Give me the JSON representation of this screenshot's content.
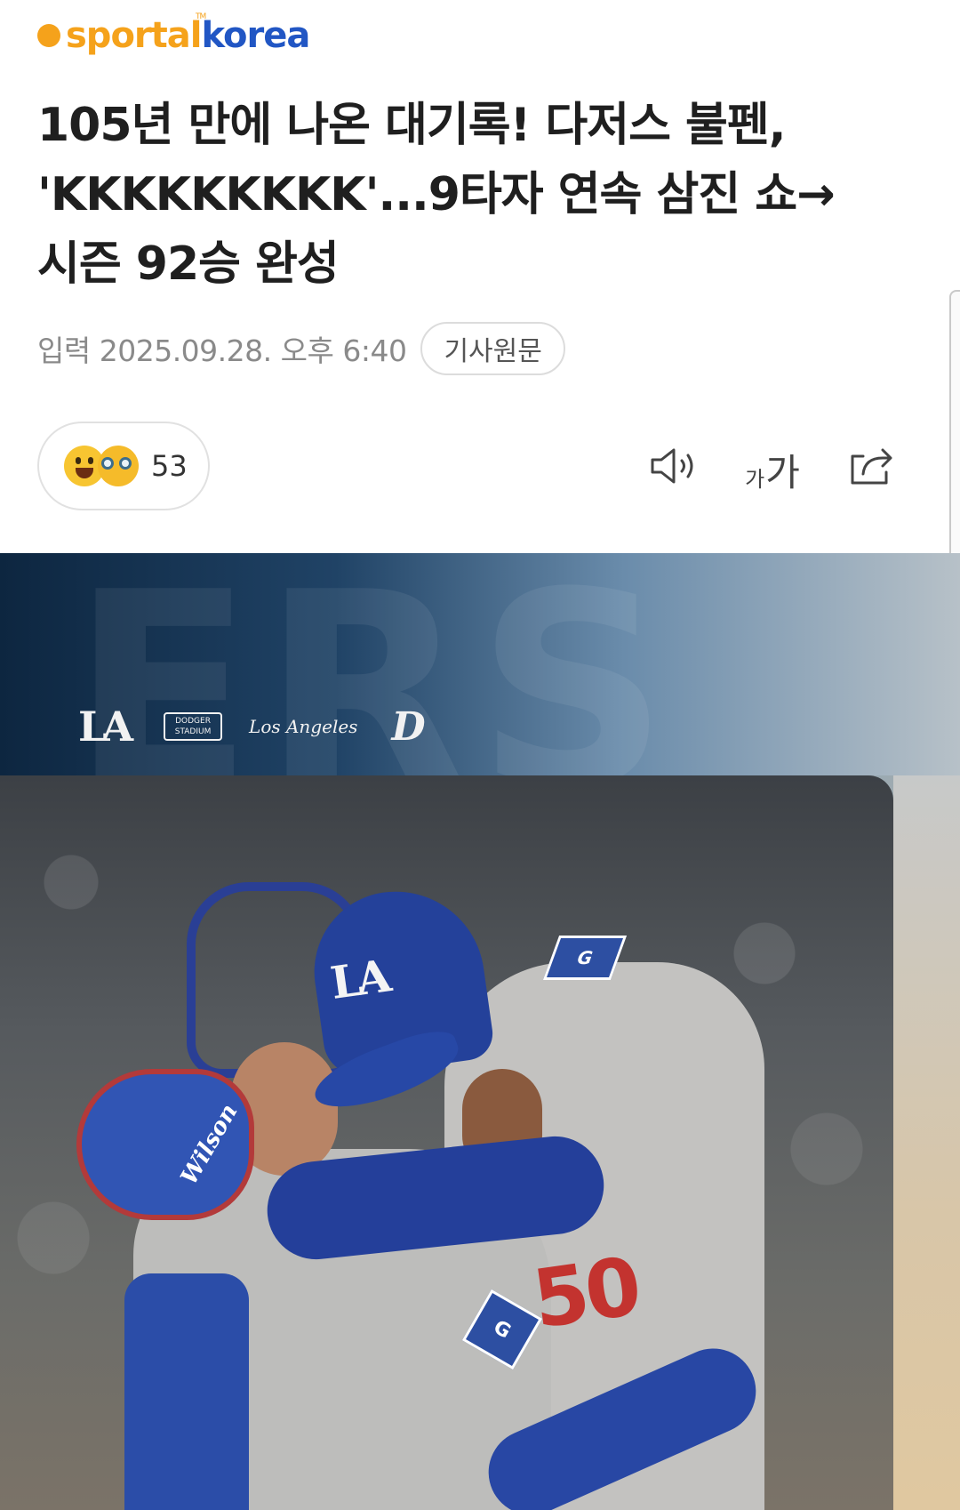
{
  "brand": {
    "logo_part1": "sportal",
    "logo_part2": "korea",
    "logo_tm": "TM",
    "accent_color": "#f5a21b",
    "secondary_color": "#2156c4"
  },
  "article": {
    "headline_lines": [
      "105년 만에 나온 대기록! 다저스 불펜,",
      "'KKKKKKKKK'...9타자 연속 삼진 쇼→",
      "시즌 92승 완성"
    ],
    "date": "입력 2025.09.28. 오후 6:40",
    "original_button": "기사원문"
  },
  "reactions": {
    "count": "53",
    "emojis": [
      "grinning-face-icon",
      "nerd-glasses-face-icon"
    ]
  },
  "tools": {
    "font_small": "가",
    "font_big": "가",
    "icons": [
      "speaker-icon",
      "font-size-icon",
      "share-icon"
    ]
  },
  "photo": {
    "strip_la": "LA",
    "strip_stadium_line1": "DODGER",
    "strip_stadium_line2": "STADIUM",
    "strip_script": "Los Angeles",
    "strip_d": "D",
    "cap_logo": "LA",
    "glove_brand": "Wilson",
    "jersey_number": "50",
    "patch_text": "G"
  }
}
